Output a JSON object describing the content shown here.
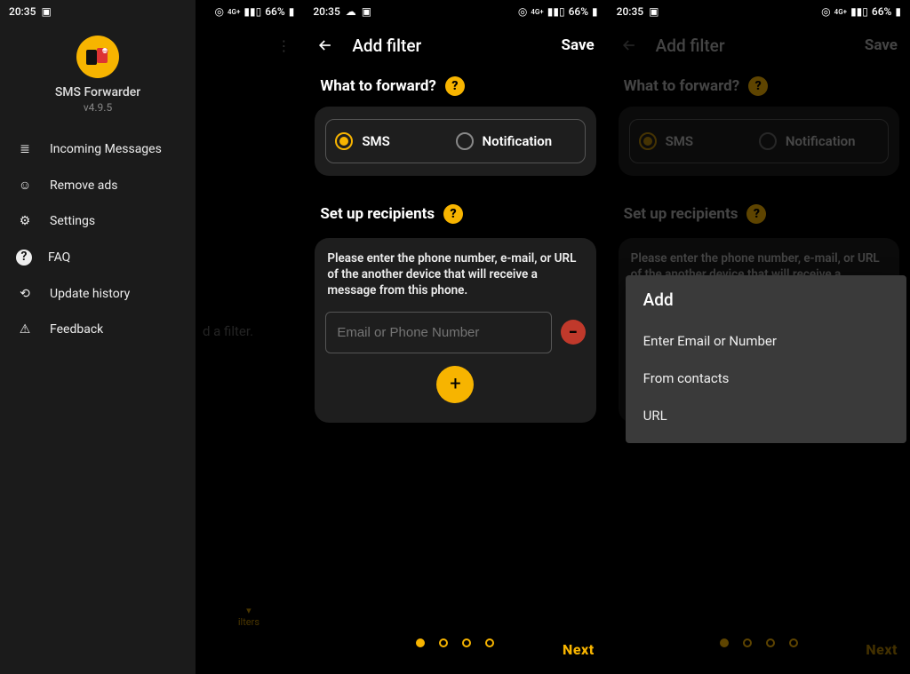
{
  "status": {
    "time": "20:35",
    "signal_label": "4G+",
    "battery_text": "66%"
  },
  "panel1": {
    "app_name": "SMS Forwarder",
    "version": "v4.9.5",
    "menu": [
      {
        "icon": "list-icon",
        "glyph": "≣",
        "label": "Incoming Messages"
      },
      {
        "icon": "smiley-icon",
        "glyph": "☺",
        "label": "Remove ads"
      },
      {
        "icon": "gear-icon",
        "glyph": "⚙",
        "label": "Settings"
      },
      {
        "icon": "question-icon",
        "glyph": "?",
        "label": "FAQ"
      },
      {
        "icon": "history-icon",
        "glyph": "⟲",
        "label": "Update history"
      },
      {
        "icon": "warning-icon",
        "glyph": "⚠",
        "label": "Feedback"
      }
    ],
    "hint_text": "d a filter.",
    "bottom_tab_label": "ilters"
  },
  "addFilter": {
    "title": "Add filter",
    "save": "Save",
    "section_forward": "What to forward?",
    "radio_sms": "SMS",
    "radio_notification": "Notification",
    "section_recipients": "Set up recipients",
    "recip_desc": "Please enter the phone number, e-mail, or URL of the another device that will receive a message from this phone.",
    "input_placeholder": "Email or Phone Number",
    "next": "Next",
    "help_glyph": "?"
  },
  "popup": {
    "title": "Add",
    "items": [
      "Enter Email or Number",
      "From contacts",
      "URL"
    ]
  }
}
